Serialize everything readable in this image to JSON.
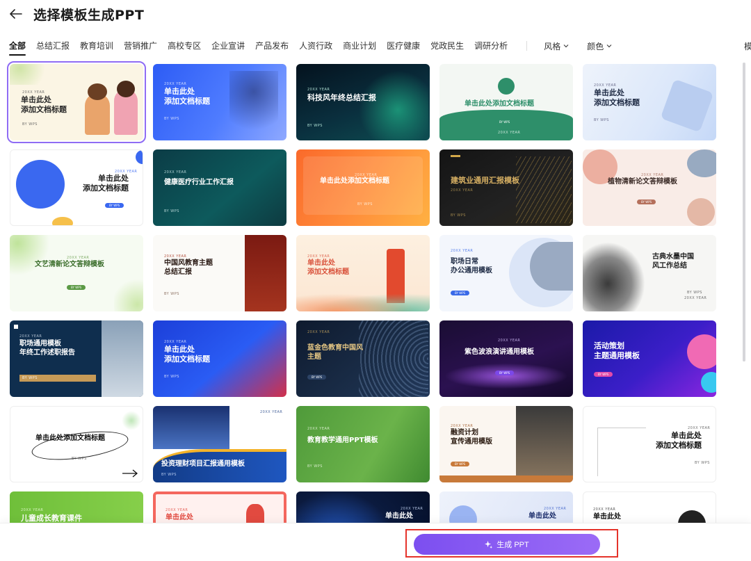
{
  "header": {
    "title": "选择模板生成PPT"
  },
  "tabs": [
    "全部",
    "总结汇报",
    "教育培训",
    "营销推广",
    "高校专区",
    "企业宣讲",
    "产品发布",
    "人资行政",
    "商业计划",
    "医疗健康",
    "党政民生",
    "调研分析"
  ],
  "filters": {
    "style": "风格",
    "color": "颜色"
  },
  "right_cut_text": "模",
  "cards": [
    {
      "big": "单击此处\n添加文档标题",
      "small": "20XX YEAR",
      "small2": "BY WPS"
    },
    {
      "big": "单击此处\n添加文档标题",
      "small": "20XX YEAR",
      "small2": "BY WPS"
    },
    {
      "big": "科技风年终总结汇报",
      "small": "20XX YEAR",
      "small2": "BY WPS"
    },
    {
      "big": "单击此处添加文档标题",
      "small": "20XX YEAR",
      "small2": "BY WPS"
    },
    {
      "big": "单击此处\n添加文档标题",
      "small": "20XX YEAR",
      "small2": "BY WPS"
    },
    {
      "big": "单击此处\n添加文档标题",
      "small": "20XX YEAR",
      "small2": "BY WPS"
    },
    {
      "big": "健康医疗行业工作汇报",
      "small": "20XX YEAR",
      "small2": "BY WPS"
    },
    {
      "big": "单击此处添加文档标题",
      "small": "20XX YEAR",
      "small2": "BY WPS"
    },
    {
      "big": "建筑业通用汇报模板",
      "small": "20XX YEAR",
      "small2": "BY WPS"
    },
    {
      "big": "植物清新论文答辩模板",
      "small": "20XX YEAR",
      "small2": "BY WPS"
    },
    {
      "big": "文艺清新论文答辩模板",
      "small": "20XX YEAR",
      "small2": "BY WPS"
    },
    {
      "big": "中国风教育主题\n总结汇报",
      "small": "20XX YEAR",
      "small2": "BY WPS"
    },
    {
      "big": "单击此处\n添加文档标题",
      "small": "20XX YEAR",
      "small2": "BY WPS"
    },
    {
      "big": "职场日常\n办公通用模板",
      "small": "20XX YEAR",
      "small2": "BY WPS"
    },
    {
      "big": "古典水墨中国\n风工作总结",
      "small": "20XX YEAR",
      "small2": "BY WPS"
    },
    {
      "big": "职场通用模板\n年终工作述职报告",
      "small": "20XX YEAR",
      "small2": "BY WPS"
    },
    {
      "big": "单击此处\n添加文档标题",
      "small": "20XX YEAR",
      "small2": "BY WPS"
    },
    {
      "big": "蓝金色教育中国风\n主题",
      "small": "20XX YEAR",
      "small2": "BY WPS"
    },
    {
      "big": "紫色波浪演讲通用模板",
      "small": "20XX YEAR",
      "small2": "BY WPS"
    },
    {
      "big": "活动策划\n主题通用模板",
      "small": "20XX YEAR",
      "small2": "BY WPS"
    },
    {
      "big": "单击此处添加文档标题",
      "small": "20XX YEAR",
      "small2": "BY WPS"
    },
    {
      "big": "投资理财项目汇报通用模板",
      "small": "20XX YEAR",
      "small2": "BY WPS"
    },
    {
      "big": "教育教学通用PPT模板",
      "small": "20XX YEAR",
      "small2": "BY WPS"
    },
    {
      "big": "融资计划\n宣传通用模版",
      "small": "20XX YEAR",
      "small2": "BY WPS"
    },
    {
      "big": "单击此处\n添加文档标题",
      "small": "20XX YEAR",
      "small2": "BY WPS"
    },
    {
      "big": "儿童成长教育课件",
      "small": "20XX YEAR",
      "small2": ""
    },
    {
      "big": "单击此处",
      "small": "20XX YEAR",
      "small2": ""
    },
    {
      "big": "单击此处",
      "small": "20XX YEAR",
      "small2": ""
    },
    {
      "big": "单击此处",
      "small": "20XX YEAR",
      "small2": ""
    },
    {
      "big": "单击此处",
      "small": "20XX YEAR",
      "small2": ""
    }
  ],
  "footer": {
    "generate_label": "生成 PPT"
  },
  "colors": {
    "accent": "#8b5cf6",
    "highlight_border": "#e5332a"
  }
}
